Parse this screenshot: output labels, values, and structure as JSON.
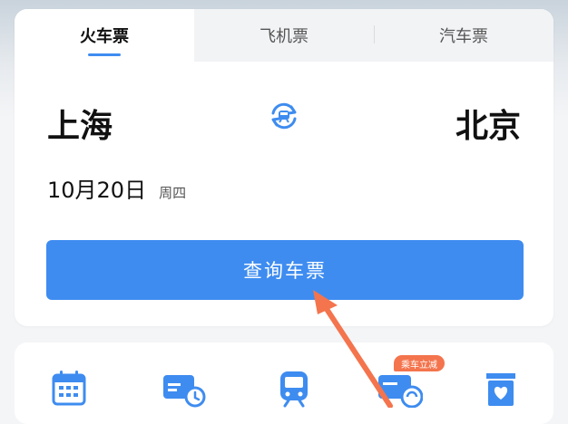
{
  "tabs": [
    {
      "label": "火车票",
      "active": true
    },
    {
      "label": "飞机票",
      "active": false
    },
    {
      "label": "汽车票",
      "active": false
    }
  ],
  "route": {
    "from_city": "上海",
    "to_city": "北京",
    "swap_icon": "swap-stations-icon"
  },
  "date": {
    "value": "10月20日",
    "weekday": "周四"
  },
  "search_button": {
    "label": "查询车票"
  },
  "shortcuts": {
    "badge": "乘车立减",
    "icons": [
      "calendar-icon",
      "ticket-clock-icon",
      "train-icon",
      "ticket-discount-icon",
      "heart-box-icon"
    ]
  },
  "colors": {
    "accent": "#3e8cf0",
    "badge": "#f4744d",
    "annotation_arrow": "#f4744d"
  }
}
